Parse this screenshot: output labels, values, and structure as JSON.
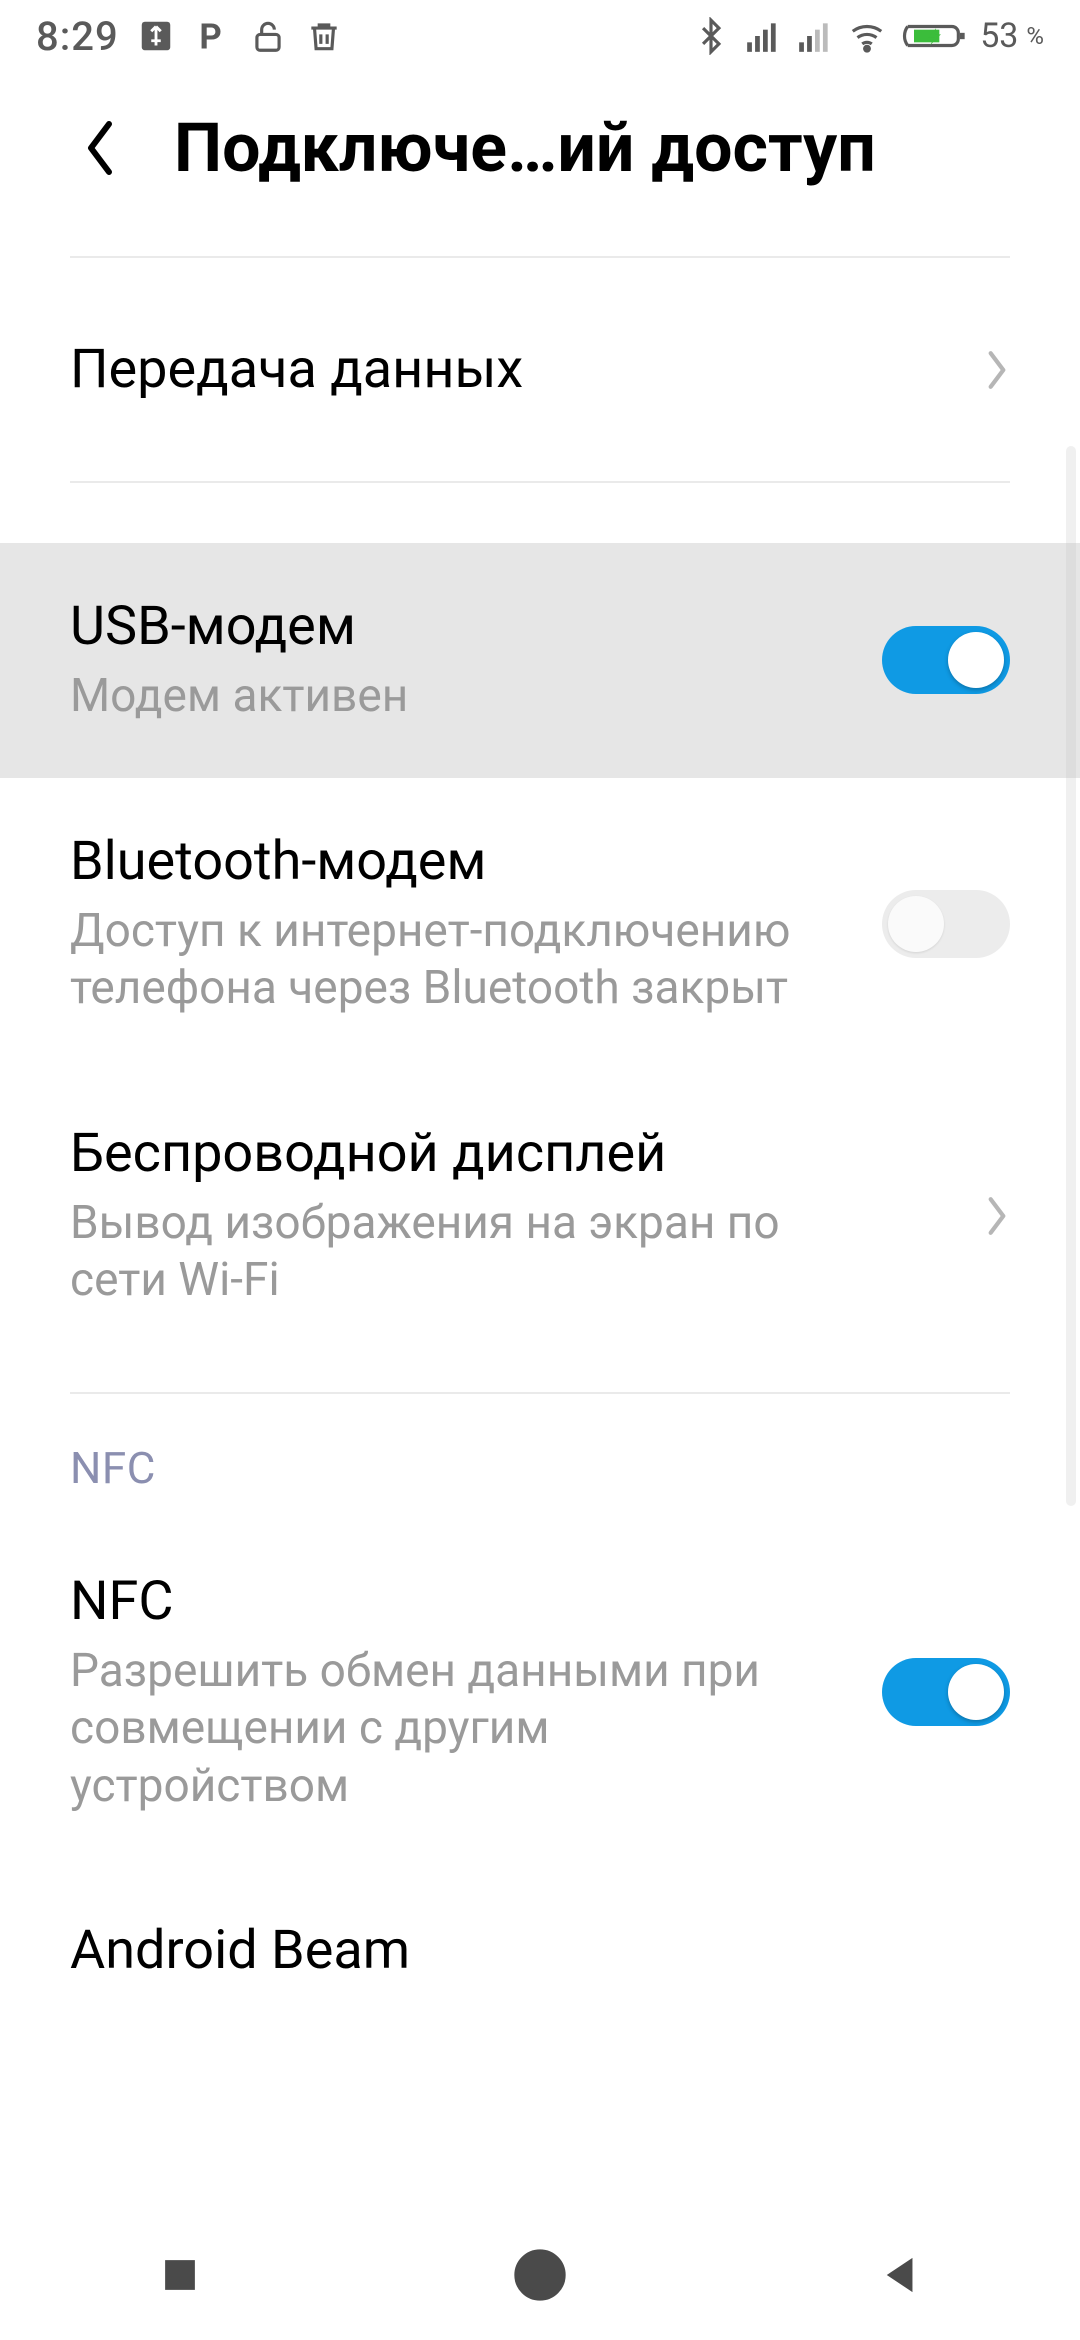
{
  "status": {
    "time": "8:29",
    "battery_percent": "53",
    "battery_unit": "%"
  },
  "header": {
    "title": "Подключе…ий доступ"
  },
  "rows": {
    "data_usage": {
      "title": "Передача данных"
    },
    "usb_tether": {
      "title": "USB-модем",
      "subtitle": "Модем активен",
      "on": true
    },
    "bt_tether": {
      "title": "Bluetooth-модем",
      "subtitle": "Доступ к интернет-подключению телефона через Bluetooth закрыт",
      "on": false
    },
    "wireless_display": {
      "title": "Беспроводной дисплей",
      "subtitle": "Вывод изображения на экран по сети Wi-Fi"
    },
    "nfc_section": "NFC",
    "nfc": {
      "title": "NFC",
      "subtitle": "Разрешить обмен данными при совмещении с другим устройством",
      "on": true
    },
    "android_beam": {
      "title": "Android Beam"
    }
  }
}
